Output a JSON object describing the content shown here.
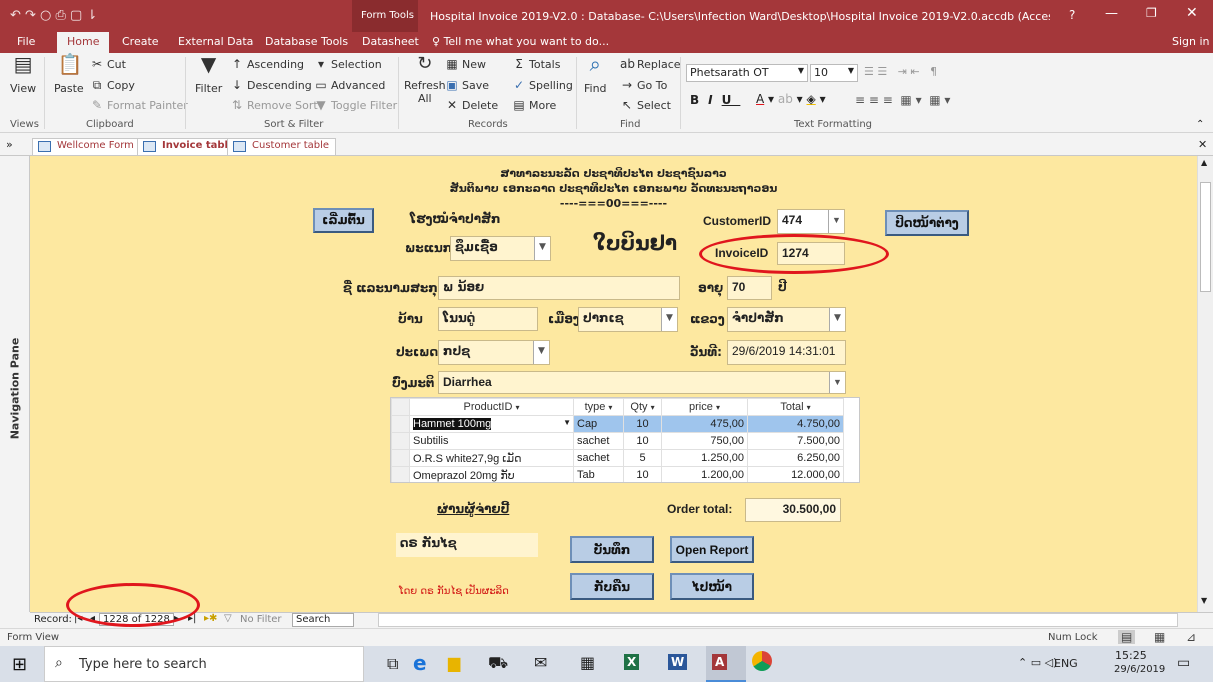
{
  "titlebar": {
    "contextual": "Form Tools",
    "title": "Hospital Invoice 2019-V2.0 : Database- C:\\Users\\Infection Ward\\Desktop\\Hospital Invoice 2019-V2.0.accdb (Access 2007 - 2016 fil...",
    "help": "?",
    "signin": "Sign in"
  },
  "menu": [
    "File",
    "Home",
    "Create",
    "External Data",
    "Database Tools",
    "Datasheet"
  ],
  "tell_me": "Tell me what you want to do...",
  "ribbon": {
    "view": "View",
    "paste": "Paste",
    "cut": "Cut",
    "copy": "Copy",
    "format_painter": "Format Painter",
    "filter": "Filter",
    "ascending": "Ascending",
    "descending": "Descending",
    "remove_sort": "Remove Sort",
    "selection": "Selection",
    "advanced": "Advanced",
    "toggle_filter": "Toggle Filter",
    "refresh": "Refresh",
    "refresh2": "All",
    "new": "New",
    "save": "Save",
    "delete": "Delete",
    "totals": "Totals",
    "spelling": "Spelling",
    "more": "More",
    "find": "Find",
    "replace": "Replace",
    "goto": "Go To",
    "select": "Select",
    "font": "Phetsarath OT",
    "size": "10",
    "groups": {
      "views": "Views",
      "clipboard": "Clipboard",
      "sort_filter": "Sort & Filter",
      "records": "Records",
      "find": "Find",
      "text": "Text Formatting"
    }
  },
  "doc_tabs": [
    "Wellcome Form",
    "Invoice table",
    "Customer table"
  ],
  "nav_pane": "Navigation Pane",
  "form": {
    "header1": "ສາທາລະນະລັດ ປະຊາທິປະໄຕ ປະຊາຊົນລາວ",
    "header2": "ສັນຕິພາບ ເອກະລາດ ປະຊາທິປະໄຕ ເອກະພາບ ວັດທະນະຖາວອນ",
    "header3": "----===00===----",
    "home_btn": "ເລີ່ມຕົ້ນ",
    "hospital": "ໂຮງໝໍຈຳປາສັກ",
    "ward_label": "ພະແນກ",
    "ward": "ຊຶມເຊື້ອ",
    "form_title": "ໃບບິນຢາ",
    "customer_label": "CustomerID",
    "customer_id": "474",
    "invoice_label": "InvoiceID",
    "invoice_id": "1274",
    "close_btn": "ປິດໜ້າຕ່າງ",
    "name_label": "ຊື່ ແລະນາມສະກຸນ",
    "name": "ພ ນ້ອຍ",
    "age_label": "ອາຍຸ",
    "age": "70",
    "age_unit": "ປີ",
    "village_label": "ບ້ານ",
    "village": "ໂນນດູ່",
    "district_label": "ເມືອງ",
    "district": "ປາກເຊ",
    "province_label": "ແຂວງ",
    "province": "ຈຳປາສັກ",
    "type_label": "ປະເພດ",
    "patient_type": "ກປຊ",
    "date_label": "ວັນທີ:",
    "date": "29/6/2019 14:31:01",
    "diagnosis_label": "ບົ່ງມະຕິ",
    "diagnosis": "Diarrhea",
    "columns": [
      "ProductID",
      "type",
      "Qty",
      "price",
      "Total"
    ],
    "rows": [
      [
        "Hammet 100mg",
        "Cap",
        "10",
        "475,00",
        "4.750,00"
      ],
      [
        "Subtilis",
        "sachet",
        "10",
        "750,00",
        "7.500,00"
      ],
      [
        "O.R.S white27,9g ເມັດ",
        "sachet",
        "5",
        "1.250,00",
        "6.250,00"
      ],
      [
        "Omeprazol 20mg ກັບ",
        "Tab",
        "10",
        "1.200,00",
        "12.000,00"
      ]
    ],
    "cashier_label": "ຜ່ານຜູ້ຈ່າຍປີ້",
    "cashier": "ດຣ ກັນໄຊ",
    "order_total_label": "Order total:",
    "order_total": "30.500,00",
    "save_btn": "ບັນທຶກ",
    "open_report_btn": "Open Report",
    "undo_btn": "ກັບຄືນ",
    "next_btn": "ໄປໜ້າ",
    "signature": "ໂດຍ ດຣ ກັນໄຊ ເປັນຜະລິດ"
  },
  "recnav": {
    "label": "Record:",
    "position": "1228 of 1228",
    "nofilter": "No Filter",
    "search": "Search"
  },
  "status": {
    "view": "Form View",
    "numlock": "Num Lock"
  },
  "taskbar": {
    "search": "Type here to search",
    "lang": "ENG",
    "time": "15:25",
    "date": "29/6/2019"
  }
}
